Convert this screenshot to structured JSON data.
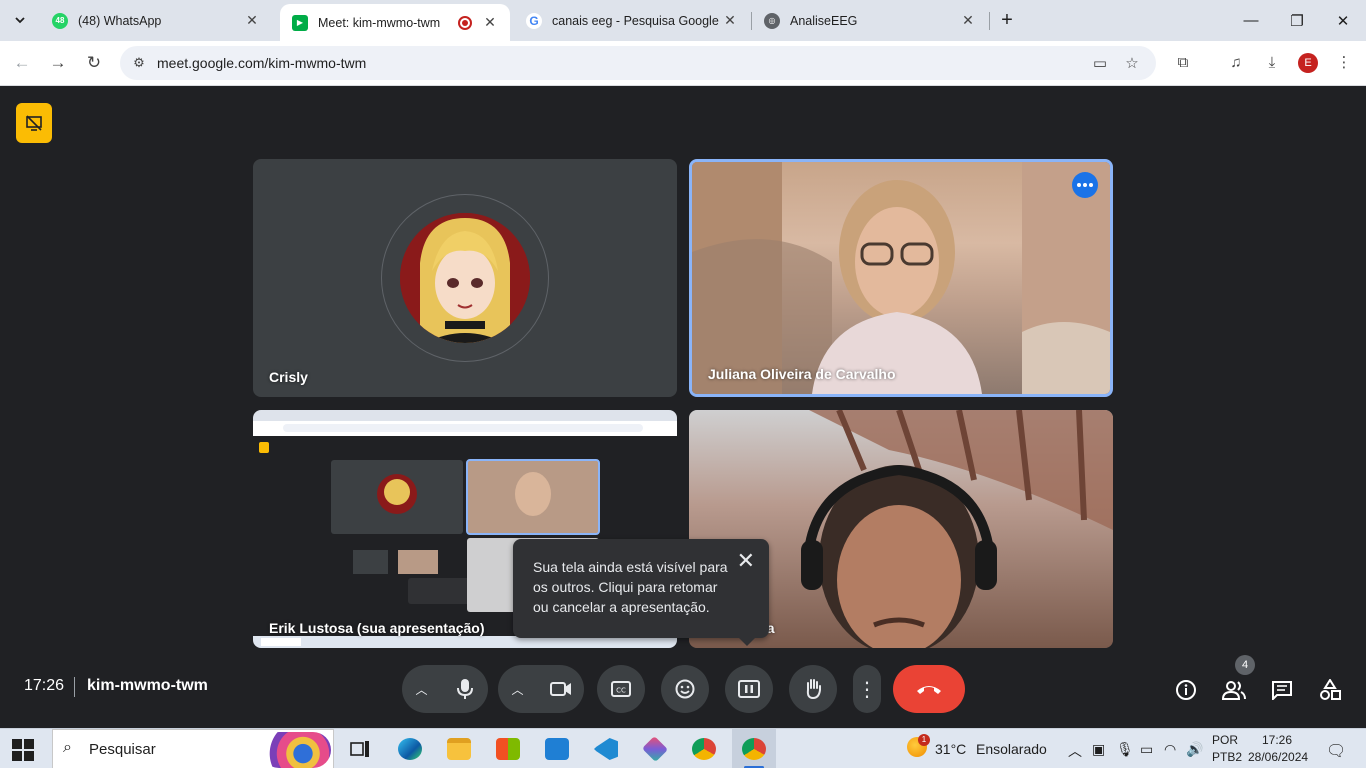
{
  "browser": {
    "tabs": [
      {
        "title": "(48) WhatsApp",
        "badge": "48",
        "active": false
      },
      {
        "title": "Meet: kim-mwmo-twm",
        "active": true,
        "recording": true
      },
      {
        "title": "canais eeg - Pesquisa Google",
        "active": false
      },
      {
        "title": "AnaliseEEG",
        "active": false
      }
    ],
    "url": "meet.google.com/kim-mwmo-twm",
    "profile_initial": "E"
  },
  "meet": {
    "participants": [
      {
        "name": "Crisly"
      },
      {
        "name": "Juliana Oliveira de Carvalho"
      },
      {
        "name": "Erik Lustosa (sua apresentação)"
      },
      {
        "name": "sa"
      }
    ],
    "toast": {
      "text": "Sua tela ainda está visível para os outros. Cliqui para retomar ou cancelar a apresentação."
    },
    "time": "17:26",
    "meeting_code": "kim-mwmo-twm",
    "people_count": "4"
  },
  "taskbar": {
    "search_placeholder": "Pesquisar",
    "weather_temp": "31°C",
    "weather_desc": "Ensolarado",
    "weather_badge": "1",
    "lang": "POR",
    "layout": "PTB2",
    "time": "17:26",
    "date": "28/06/2024"
  },
  "colors": {
    "meet_bg": "#202124",
    "tile_bg": "#3c4043",
    "active_speaker_border": "#8ab4f8",
    "hangup_red": "#ea4335",
    "presenting_badge": "#fbbc04"
  }
}
